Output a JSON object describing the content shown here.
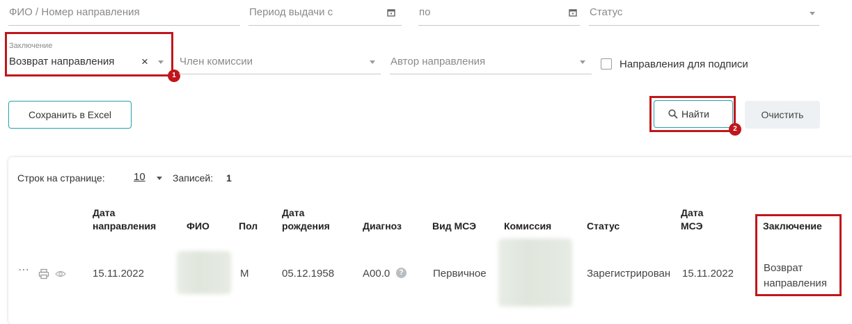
{
  "filters": {
    "fio_placeholder": "ФИО / Номер направления",
    "period_from_placeholder": "Период выдачи с",
    "period_to_placeholder": "по",
    "status_placeholder": "Статус",
    "conclusion_label": "Заключение",
    "conclusion_value": "Возврат направления",
    "commission_member_placeholder": "Член комиссии",
    "author_placeholder": "Автор направления",
    "sign_checkbox_label": "Направления для подписи",
    "sign_checkbox_checked": false
  },
  "annotations": {
    "badge1": "1",
    "badge2": "2",
    "color": "#c0161b"
  },
  "buttons": {
    "save_excel": "Сохранить в Excel",
    "find": "Найти",
    "clear": "Очистить"
  },
  "table": {
    "rows_per_page_label": "Строк на странице:",
    "rows_per_page_value": "10",
    "records_label": "Записей:",
    "records_count": "1",
    "headers": {
      "date_direction_1": "Дата",
      "date_direction_2": "направления",
      "fio": "ФИО",
      "sex": "Пол",
      "birth_1": "Дата",
      "birth_2": "рождения",
      "diagnosis": "Диагноз",
      "mse_type": "Вид МСЭ",
      "commission": "Комиссия",
      "status": "Статус",
      "mse_date_1": "Дата",
      "mse_date_2": "МСЭ",
      "conclusion": "Заключение"
    },
    "rows": [
      {
        "date_direction": "15.11.2022",
        "sex": "М",
        "birth_date": "05.12.1958",
        "diagnosis": "A00.0",
        "mse_type": "Первичное",
        "status": "Зарегистрирован",
        "mse_date": "15.11.2022",
        "conclusion_1": "Возврат",
        "conclusion_2": "направления"
      }
    ]
  }
}
